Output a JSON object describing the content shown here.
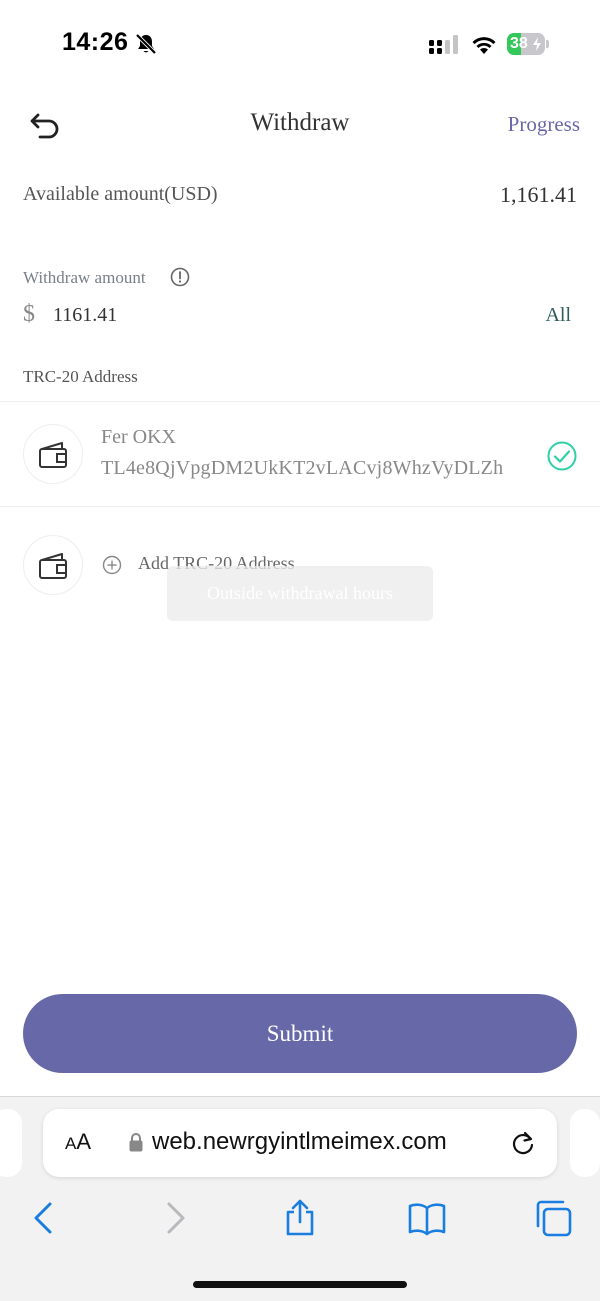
{
  "status_bar": {
    "time": "14:26",
    "battery_level": "38",
    "battery_fraction": 0.38,
    "icons": [
      "bell-slash-icon",
      "signal-icon",
      "wifi-icon",
      "battery-charging-icon"
    ]
  },
  "header": {
    "title": "Withdraw",
    "progress_label": "Progress",
    "back_icon": "undo-arrow-icon"
  },
  "available": {
    "label": "Available amount(USD)",
    "value": "1,161.41"
  },
  "withdraw": {
    "label": "Withdraw amount",
    "info_icon": "info-circle-icon",
    "currency_symbol": "$",
    "amount_value": "1161.41",
    "all_label": "All"
  },
  "address_section": {
    "label": "TRC-20 Address",
    "addresses": [
      {
        "name": "Fer OKX",
        "address": "TL4e8QjVpgDM2UkKT2vLACvj8WhzVyDLZh",
        "selected": true
      }
    ],
    "add_label": "Add TRC-20 Address"
  },
  "toast": {
    "message": "Outside withdrawal hours"
  },
  "submit_label": "Submit",
  "browser": {
    "aa_small": "A",
    "aa_big": "A",
    "url": "web.newrgyintlmeimex.com",
    "nav_icons": [
      "back-chevron-icon",
      "forward-chevron-icon",
      "share-icon",
      "bookmarks-icon",
      "tabs-icon"
    ]
  },
  "colors": {
    "accent": "#6768a7",
    "progress_link": "#6a67a8",
    "all_link": "#2e5c5a",
    "check": "#2fcfa8",
    "battery_fill": "#34c759",
    "safari_blue": "#1a7de0"
  }
}
